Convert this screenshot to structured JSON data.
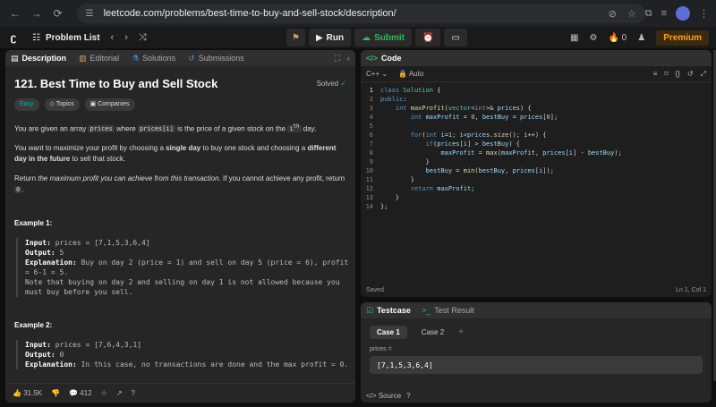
{
  "browser": {
    "url": "leetcode.com/problems/best-time-to-buy-and-sell-stock/description/"
  },
  "topbar": {
    "problem_list": "Problem List",
    "run": "Run",
    "submit": "Submit",
    "streak_count": "0",
    "premium": "Premium"
  },
  "left": {
    "tabs": [
      "Description",
      "Editorial",
      "Solutions",
      "Submissions"
    ],
    "title": "121. Best Time to Buy and Sell Stock",
    "solved": "Solved",
    "tags": [
      "Easy",
      "Topics",
      "Companies"
    ],
    "p1_a": "You are given an array ",
    "p1_code1": "prices",
    "p1_b": " where ",
    "p1_code2": "prices[i]",
    "p1_c": " is the price of a given stock on the ",
    "p1_code3": "i",
    "p1_sup": "th",
    "p1_d": " day.",
    "p2_a": "You want to maximize your profit by choosing a ",
    "p2_b1": "single day",
    "p2_b": " to buy one stock and choosing a ",
    "p2_b2": "different day in the future",
    "p2_c": " to sell that stock.",
    "p3_a": "Return ",
    "p3_i": "the maximum profit you can achieve from this transaction",
    "p3_b": ". If you cannot achieve any profit, return ",
    "p3_code": "0",
    "p3_c": ".",
    "ex1_title": "Example 1:",
    "ex1_input_label": "Input:",
    "ex1_input": " prices = [7,1,5,3,6,4]",
    "ex1_output_label": "Output:",
    "ex1_output": " 5",
    "ex1_expl_label": "Explanation:",
    "ex1_expl": " Buy on day 2 (price = 1) and sell on day 5 (price = 6), profit\n= 6-1 = 5.\nNote that buying on day 2 and selling on day 1 is not allowed because you\nmust buy before you sell.",
    "ex2_title": "Example 2:",
    "ex2_input_label": "Input:",
    "ex2_input": " prices = [7,6,4,3,1]",
    "ex2_output_label": "Output:",
    "ex2_output": " 0",
    "ex2_expl_label": "Explanation:",
    "ex2_expl": " In this case, no transactions are done and the max profit = 0.",
    "likes": "31.5K",
    "comments": "412"
  },
  "code": {
    "header": "Code",
    "language": "C++",
    "autosave": "Auto",
    "saved": "Saved",
    "cursor": "Ln 1, Col 1"
  },
  "test": {
    "tab1": "Testcase",
    "tab2": "Test Result",
    "cases": [
      "Case 1",
      "Case 2"
    ],
    "param_label": "prices =",
    "param_value": "[7,1,5,3,6,4]",
    "source": "Source"
  },
  "colors": {
    "accent_green": "#2cbb5d",
    "premium_orange": "#ffa116",
    "easy_teal": "#00b8a3"
  }
}
